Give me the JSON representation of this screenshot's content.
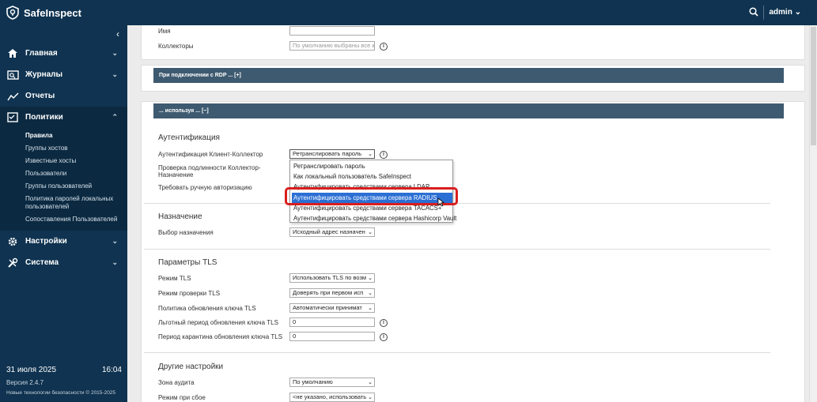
{
  "brand": {
    "name": "SafeInspect"
  },
  "topbar": {
    "user": "admin"
  },
  "nav": {
    "items": [
      {
        "label": "Главная"
      },
      {
        "label": "Журналы"
      },
      {
        "label": "Отчеты"
      },
      {
        "label": "Политики"
      },
      {
        "label": "Настройки"
      },
      {
        "label": "Система"
      }
    ],
    "politics_sub": [
      "Правила",
      "Группы хостов",
      "Известные хосты",
      "Пользователи",
      "Группы пользователей",
      "Политика паролей локальных пользователей",
      "Сопоставления Пользователей"
    ]
  },
  "footer": {
    "date": "31 июля 2025",
    "time": "16:04",
    "version": "Версия 2.4.7",
    "copyright": "Новые технологии безопасности © 2015-2025"
  },
  "top_card": {
    "name_label": "Имя",
    "collectors_label": "Коллекторы",
    "collectors_placeholder": "По умолчанию выбраны все кс"
  },
  "rdp_bar": "При подключении с RDP ... [+]",
  "using_bar": "... используя ... [−]",
  "auth": {
    "title": "Аутентификация",
    "client_collector_label": "Аутентификация Клиент-Коллектор",
    "client_collector_value": "Ретранслировать пароль",
    "verify_label_1": "Проверка подлинности Коллектор-",
    "verify_label_2": "Назначение",
    "manual_auth_label": "Требовать ручную авторизацию",
    "options": [
      "Ретранслировать пароль",
      "Как локальный пользователь SafeInspect",
      "Аутентифицировать средствами сервера LDAP",
      "Аутентифицировать средствами сервера RADIUS",
      "Аутентифицировать средствами сервера TACACS+",
      "Аутентифицировать средствами сервера Hashicorp Vault"
    ]
  },
  "destination": {
    "title": "Назначение",
    "select_label": "Выбор назначения",
    "select_value": "Исходный адрес назначен"
  },
  "tls": {
    "title": "Параметры TLS",
    "mode_label": "Режим TLS",
    "mode_value": "Использовать TLS по возм",
    "check_label": "Режим проверки TLS",
    "check_value": "Доверять при первом исп",
    "policy_label": "Политика обновления ключа TLS",
    "policy_value": "Автоматически принимат",
    "grace_label": "Льготный период обновления ключа TLS",
    "grace_value": "0",
    "quarantine_label": "Период карантина обновления ключа TLS",
    "quarantine_value": "0"
  },
  "other": {
    "title": "Другие настройки",
    "audit_label": "Зона аудита",
    "audit_value": "По умолчанию",
    "failure_label": "Режим при сбое",
    "failure_value": "<не указано, использовать"
  }
}
